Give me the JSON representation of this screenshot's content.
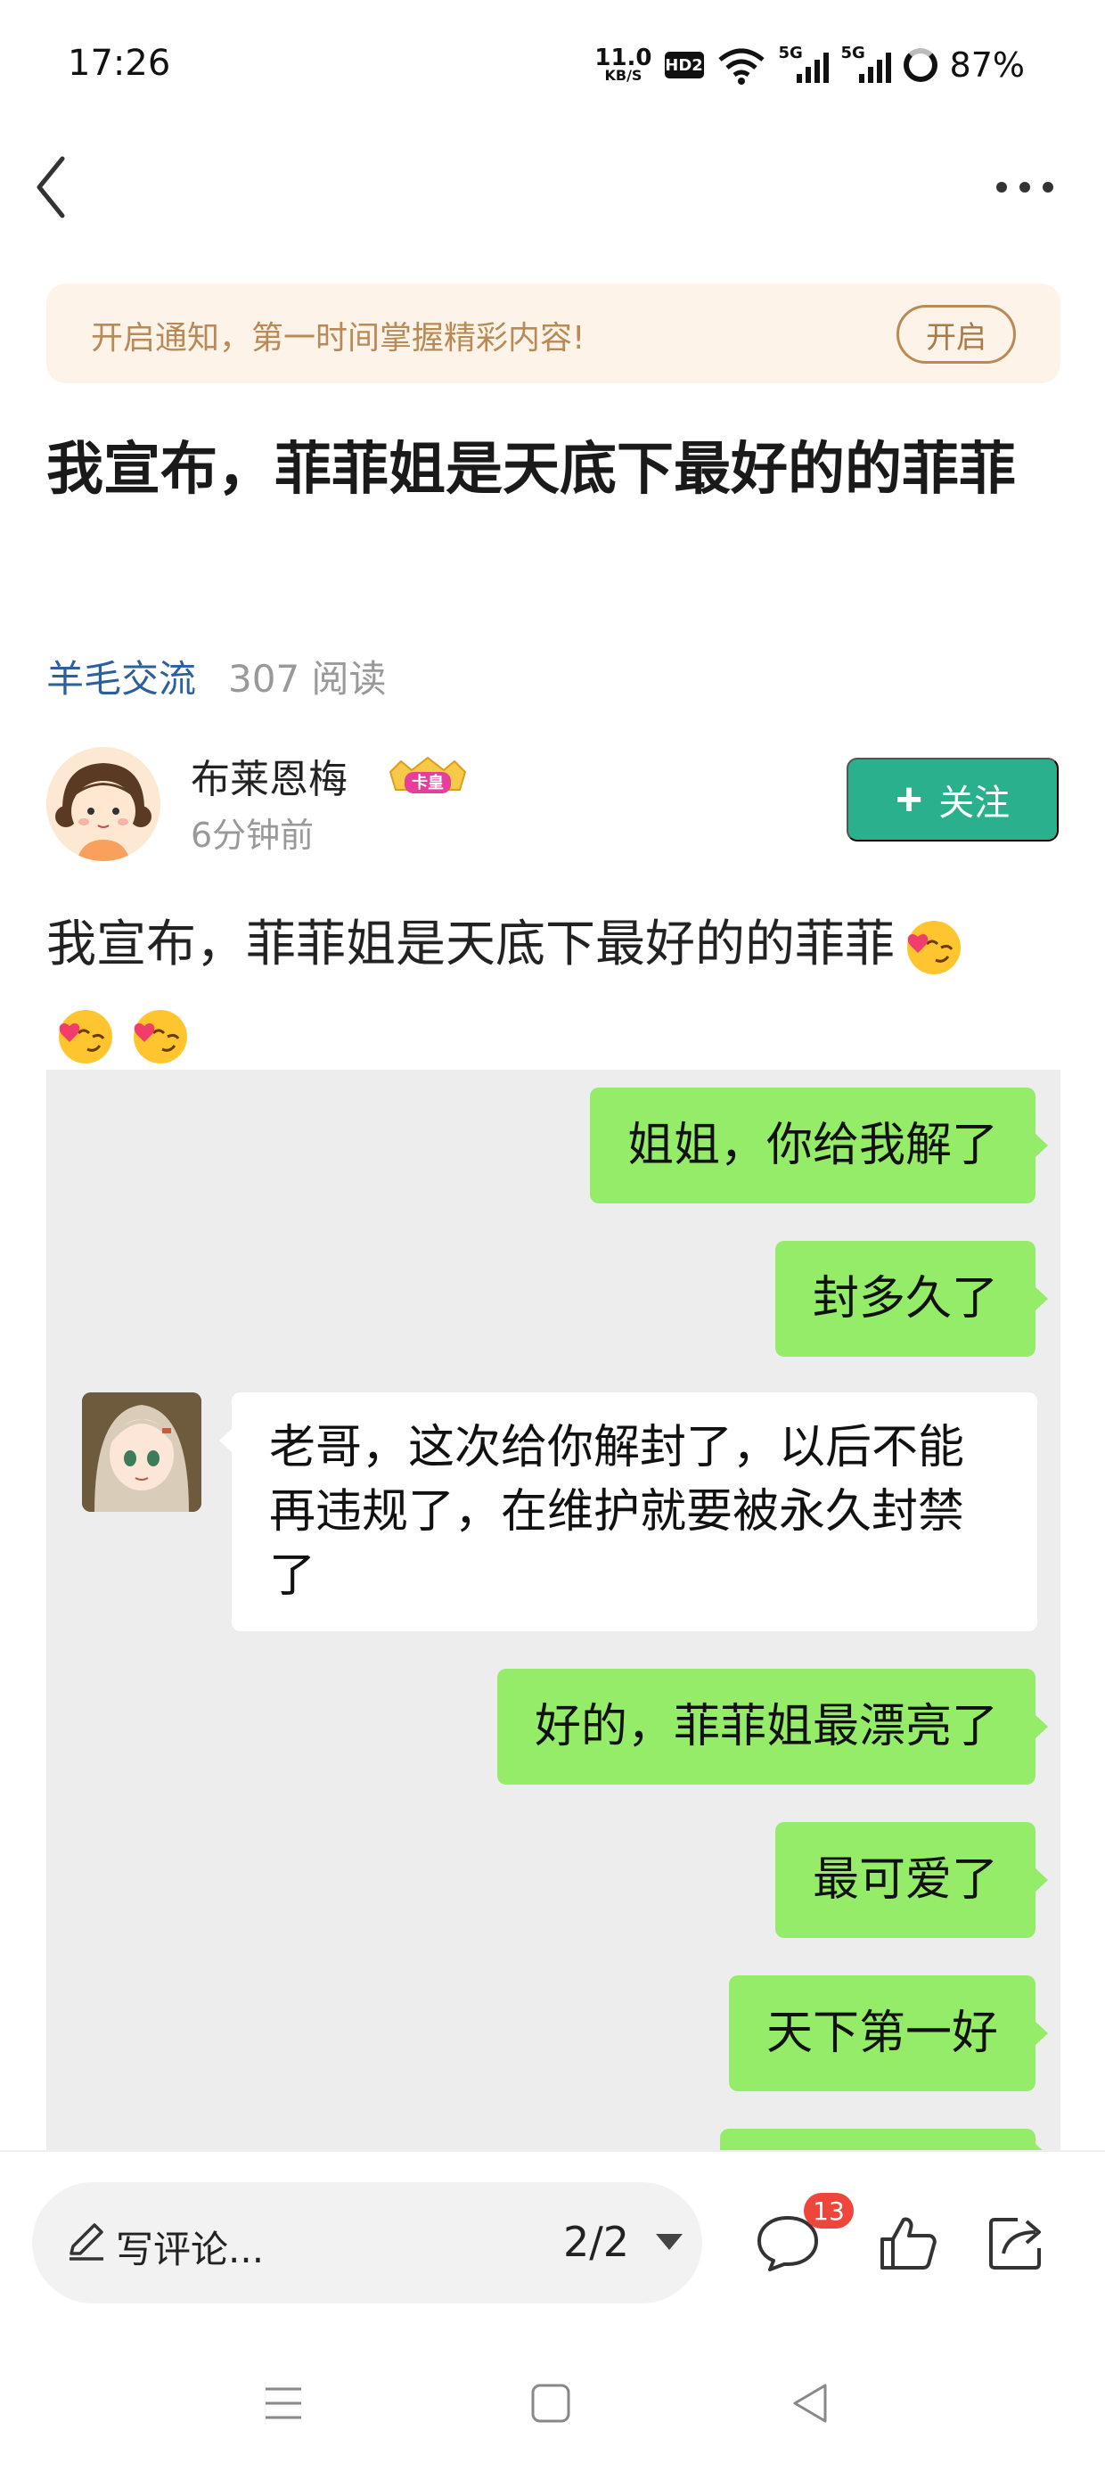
{
  "status_bar": {
    "time": "17:26",
    "net_speed_value": "11.0",
    "net_speed_unit": "KB/S",
    "hd_label": "HD2",
    "signal1_label": "5G",
    "signal2_label": "5G",
    "battery": "87%"
  },
  "nav": {
    "back_icon": "chevron-left-icon",
    "more_icon": "more-dots-icon"
  },
  "notify": {
    "text": "开启通知，第一时间掌握精彩内容!",
    "button": "开启"
  },
  "post": {
    "title": "我宣布，菲菲姐是天底下最好的的菲菲",
    "category": "羊毛交流",
    "reads": "307 阅读",
    "author": {
      "name": "布莱恩梅",
      "badge": "卡皇",
      "time": "6分钟前"
    },
    "follow_label": "关注",
    "body": "我宣布，菲菲姐是天底下最好的的菲菲"
  },
  "chat": {
    "messages": [
      {
        "from": "me",
        "text": "姐姐，你给我解了"
      },
      {
        "from": "me",
        "text": "封多久了"
      },
      {
        "from": "them",
        "text": "老哥，这次给你解封了，以后不能再违规了，在维护就要被永久封禁了"
      },
      {
        "from": "me",
        "text": "好的，菲菲姐最漂亮了"
      },
      {
        "from": "me",
        "text": "最可爱了"
      },
      {
        "from": "me",
        "text": "天下第一好"
      }
    ],
    "colors": {
      "me_bubble": "#95ec69",
      "them_bubble": "#ffffff",
      "background": "#ededed"
    }
  },
  "bottom_bar": {
    "comment_placeholder": "写评论...",
    "page_indicator": "2/2",
    "comment_count": "13"
  },
  "colors": {
    "accent": "#2bb08e",
    "category": "#2b5f9e",
    "notify_text": "#b98a55",
    "badge": "#f0453a"
  }
}
